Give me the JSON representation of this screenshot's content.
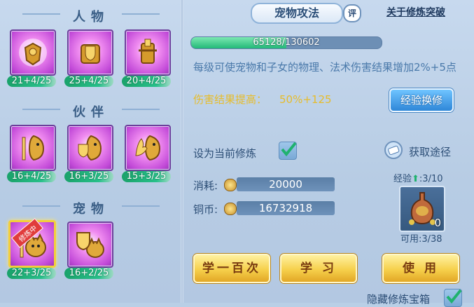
{
  "sections": {
    "character": {
      "title": "人物",
      "skills": [
        {
          "level": "21+4/25",
          "icon": "armor-icon"
        },
        {
          "level": "25+4/25",
          "icon": "shield-body-icon"
        },
        {
          "level": "20+4/25",
          "icon": "warrior-icon"
        }
      ]
    },
    "partner": {
      "title": "伙伴",
      "skills": [
        {
          "level": "16+4/25",
          "icon": "partner-sword-icon"
        },
        {
          "level": "16+3/25",
          "icon": "partner-shield-icon"
        },
        {
          "level": "15+3/25",
          "icon": "partner-palm-icon"
        }
      ]
    },
    "pet": {
      "title": "宠物",
      "skills": [
        {
          "level": "22+3/25",
          "icon": "pet-attack-icon",
          "selected": true,
          "ribbon": "修炼中"
        },
        {
          "level": "16+2/25",
          "icon": "pet-defense-icon"
        }
      ]
    }
  },
  "detail": {
    "title": "宠物攻法",
    "eval_label": "评",
    "about_link": "关于修炼突破",
    "exp_current": 65128,
    "exp_max": 130602,
    "exp_text": "65128/130602",
    "exp_fraction": 0.4987,
    "description": "每级可使宠物和子女的物理、法术伤害结果增加2%+5点",
    "boost_label": "伤害结果提高：",
    "boost_value": "50%+125",
    "exchange_button": "经验换修",
    "set_current_label": "设为当前修炼",
    "set_current_checked": true,
    "acquire_label": "获取途径",
    "cost_label": "消耗:",
    "cost_value": "20000",
    "copper_label": "铜币:",
    "copper_value": "16732918",
    "exp_item_label": "经验",
    "exp_item_ratio": ":3/10",
    "item_count": "0",
    "available_label": "可用:3/38",
    "buttons": {
      "learn_hundred": "学一百次",
      "learn": "学 习",
      "use": "使 用"
    },
    "hide_label": "隐藏修炼宝箱"
  },
  "colors": {
    "accent_gold": "#e7bc2a",
    "exp_fill": "#23b978",
    "text_blue": "#4a79aa"
  }
}
